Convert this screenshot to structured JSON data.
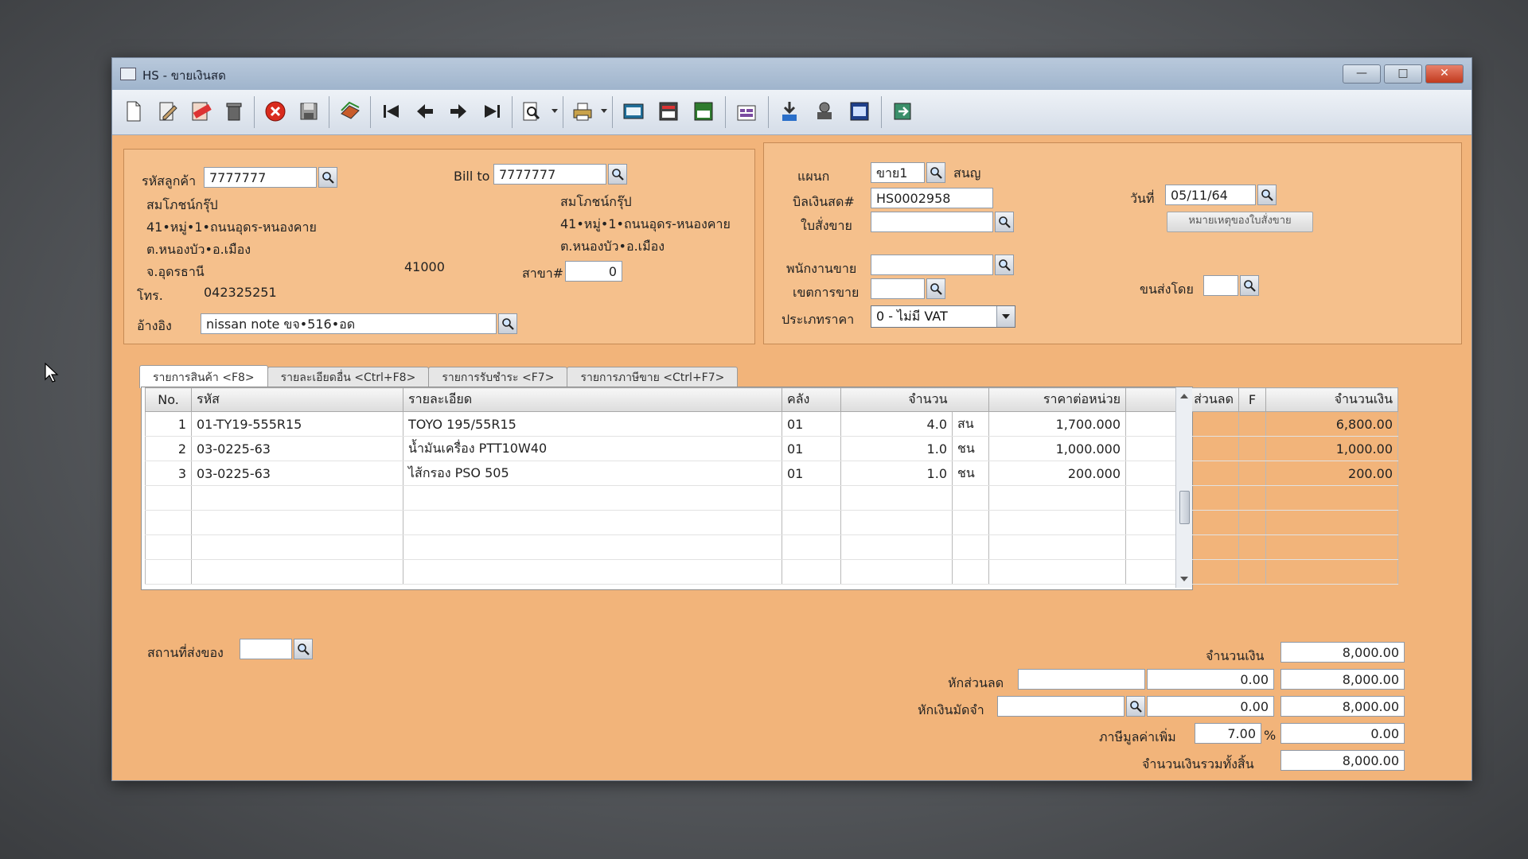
{
  "window": {
    "title": "HS - ขายเงินสด",
    "controls": {
      "minimize": "—",
      "maximize": "□",
      "close": "✕"
    }
  },
  "toolbar": {
    "icons": [
      "new-document-icon",
      "edit-icon",
      "void-icon",
      "delete-trash-icon",
      "cancel-icon",
      "save-icon",
      "copy-icon",
      "first-record-icon",
      "previous-record-icon",
      "next-record-icon",
      "last-record-icon",
      "search-record-icon",
      "print-icon",
      "batch-icon",
      "report-icon",
      "so-icon",
      "rehl-icon",
      "approve-ok-icon",
      "stamp-ok-icon",
      "ok-icon",
      "exit-icon"
    ]
  },
  "customer": {
    "code_label": "รหัสลูกค้า",
    "code_value": "7777777",
    "name": "สมโภชน์กรุ๊ป",
    "address1": "41•หมู่•1•ถนนอุดร-หนองคาย",
    "address2": "ต.หนองบัว•อ.เมือง",
    "province": "จ.อุดรธานี",
    "postcode": "41000",
    "phone_label": "โทร.",
    "phone": "042325251",
    "ref_label": "อ้างอิง",
    "ref_value": "nissan note ขจ•516•อด"
  },
  "bill_to": {
    "label": "Bill to",
    "value": "7777777",
    "name": "สมโภชน์กรุ๊ป",
    "address1": "41•หมู่•1•ถนนอุดร-หนองคาย",
    "address2": "ต.หนองบัว•อ.เมือง",
    "branch_label": "สาขา#",
    "branch_value": "0"
  },
  "doc": {
    "dept_label": "แผนก",
    "dept_value": "ขาย1",
    "dept_name": "สนญ",
    "bill_label": "บิลเงินสด#",
    "bill_value": "HS0002958",
    "order_label": "ใบสั่งขาย",
    "order_value": "",
    "date_label": "วันที่",
    "date_value": "05/11/64",
    "note_button": "หมายเหตุของใบสั่งขาย",
    "salesman_label": "พนักงานขาย",
    "salesman_value": "",
    "area_label": "เขตการขาย",
    "area_value": "",
    "shipby_label": "ขนส่งโดย",
    "shipby_value": "",
    "pricetype_label": "ประเภทราคา",
    "pricetype_value": "0 - ไม่มี VAT"
  },
  "tabs": [
    "รายการสินค้า <F8>",
    "รายละเอียดอื่น <Ctrl+F8>",
    "รายการรับชำระ <F7>",
    "รายการภาษีขาย <Ctrl+F7>"
  ],
  "grid": {
    "headers": [
      "No.",
      "รหัส",
      "รายละเอียด",
      "คลัง",
      "จำนวน",
      "",
      "ราคาต่อหน่วย",
      "ส่วนลด",
      "F",
      "จำนวนเงิน"
    ],
    "rows": [
      {
        "no": "1",
        "code": "01-TY19-555R15",
        "desc": "TOYO 195/55R15",
        "wh": "01",
        "qty": "4.0",
        "unit": "สน",
        "price": "1,700.000",
        "disc": "",
        "f": "",
        "amount": "6,800.00"
      },
      {
        "no": "2",
        "code": "03-0225-63",
        "desc": "น้ำมันเครื่อง PTT10W40",
        "wh": "01",
        "qty": "1.0",
        "unit": "ชน",
        "price": "1,000.000",
        "disc": "",
        "f": "",
        "amount": "1,000.00"
      },
      {
        "no": "3",
        "code": "03-0225-63",
        "desc": "ไส้กรอง PSO 505",
        "wh": "01",
        "qty": "1.0",
        "unit": "ชน",
        "price": "200.000",
        "disc": "",
        "f": "",
        "amount": "200.00"
      }
    ]
  },
  "footer": {
    "ship_place_label": "สถานที่ส่งของ",
    "ship_place_value": "",
    "amount_label": "จำนวนเงิน",
    "amount_value": "8,000.00",
    "discount_label": "หักส่วนลด",
    "discount_text": "",
    "discount_amount": "0.00",
    "after_discount": "8,000.00",
    "deposit_label": "หักเงินมัดจำ",
    "deposit_text": "",
    "deposit_amount": "0.00",
    "after_deposit": "8,000.00",
    "vat_label": "ภาษีมูลค่าเพิ่ม",
    "vat_rate": "7.00",
    "vat_pct": "%",
    "vat_amount": "0.00",
    "total_label": "จำนวนเงินรวมทั้งสิ้น",
    "total_value": "8,000.00"
  }
}
